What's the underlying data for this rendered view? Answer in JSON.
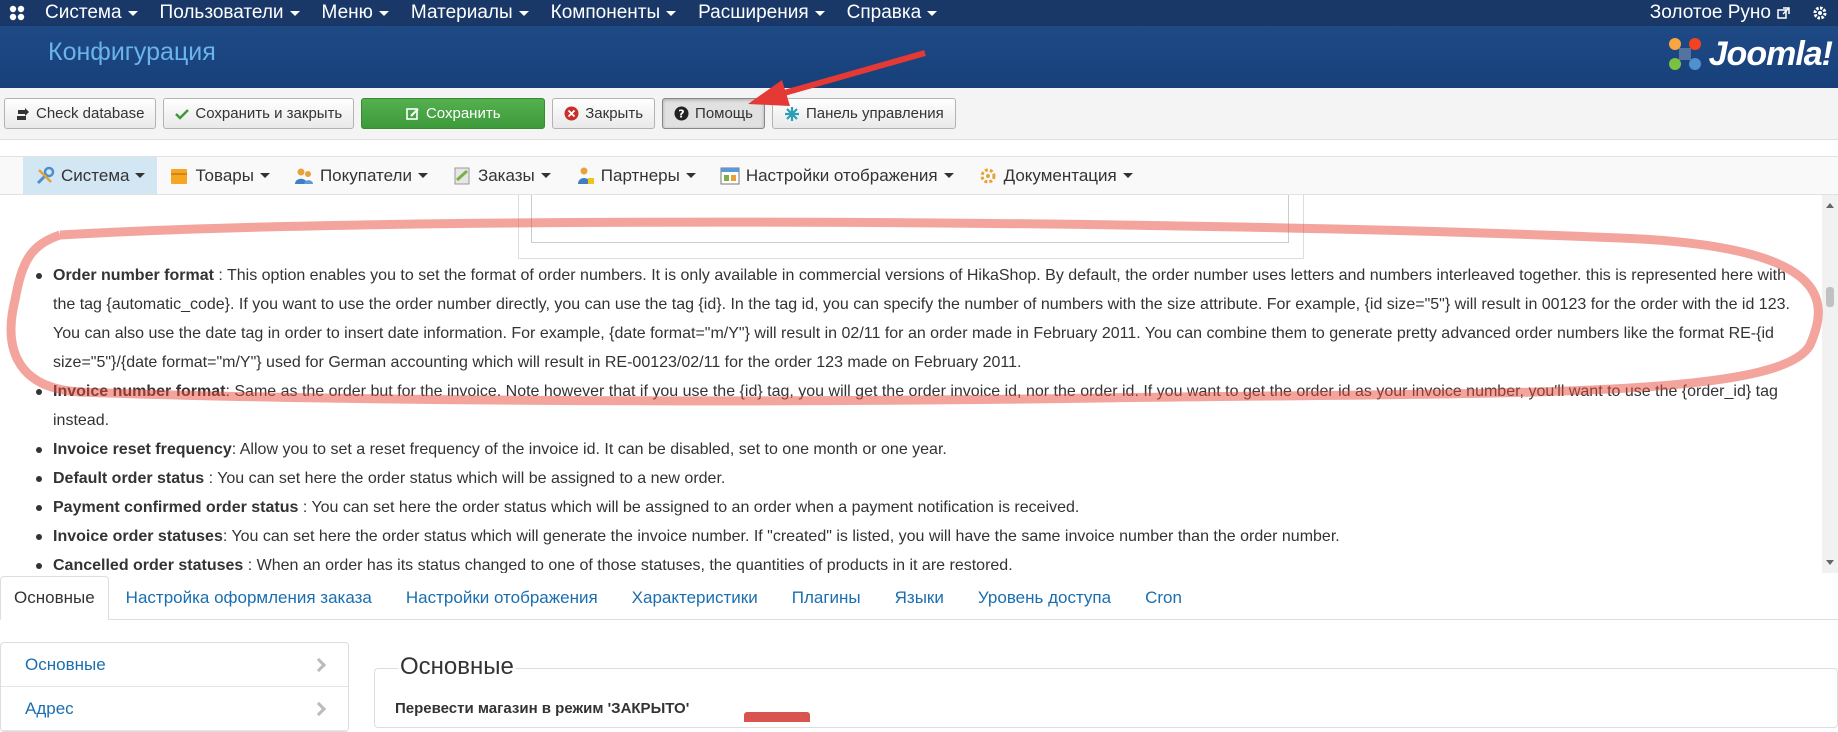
{
  "topnav": {
    "items": [
      {
        "label": "Система"
      },
      {
        "label": "Пользователи"
      },
      {
        "label": "Меню"
      },
      {
        "label": "Материалы"
      },
      {
        "label": "Компоненты"
      },
      {
        "label": "Расширения"
      },
      {
        "label": "Справка"
      }
    ],
    "site_name": "Золотое Руно"
  },
  "header": {
    "title": "Конфигурация",
    "brand": "Joomla!"
  },
  "toolbar": {
    "check_db": "Check database",
    "save_close": "Сохранить и закрыть",
    "save": "Сохранить",
    "close": "Закрыть",
    "help": "Помощь",
    "dashboard": "Панель управления"
  },
  "hikamenu": {
    "items": [
      {
        "label": "Система"
      },
      {
        "label": "Товары"
      },
      {
        "label": "Покупатели"
      },
      {
        "label": "Заказы"
      },
      {
        "label": "Партнеры"
      },
      {
        "label": "Настройки отображения"
      },
      {
        "label": "Документация"
      }
    ]
  },
  "help": {
    "items": [
      {
        "term": "Order number format",
        "text": " : This option enables you to set the format of order numbers. It is only available in commercial versions of HikaShop. By default, the order number uses letters and numbers interleaved together. this is represented here with the tag {automatic_code}. If you want to use the order number directly, you can use the tag {id}. In the tag id, you can specify the number of numbers with the size attribute. For example, {id size=\"5\"} will result in 00123 for the order with the id 123. You can also use the date tag in order to insert date information. For example, {date format=\"m/Y\"} will result in 02/11 for an order made in February 2011. You can combine them to generate pretty advanced order numbers like the format RE-{id size=\"5\"}/{date format=\"m/Y\"} used for German accounting which will result in RE-00123/02/11 for the order 123 made on February 2011."
      },
      {
        "term": "Invoice number format",
        "text": ": Same as the order but for the invoice. Note however that if you use the {id} tag, you will get the order invoice id, nor the order id. If you want to get the order id as your invoice number, you'll want to use the {order_id} tag instead."
      },
      {
        "term": "Invoice reset frequency",
        "text": ": Allow you to set a reset frequency of the invoice id. It can be disabled, set to one month or one year."
      },
      {
        "term": "Default order status",
        "text": " : You can set here the order status which will be assigned to a new order."
      },
      {
        "term": "Payment confirmed order status",
        "text": " : You can set here the order status which will be assigned to an order when a payment notification is received."
      },
      {
        "term": "Invoice order statuses",
        "text": ": You can set here the order status which will generate the invoice number. If \"created\" is listed, you will have the same invoice number than the order number."
      },
      {
        "term": "Cancelled order statuses",
        "text": " : When an order has its status changed to one of those statuses, the quantities of products in it are restored."
      }
    ]
  },
  "tabs": [
    {
      "label": "Основные"
    },
    {
      "label": "Настройка оформления заказа"
    },
    {
      "label": "Настройки отображения"
    },
    {
      "label": "Характеристики"
    },
    {
      "label": "Плагины"
    },
    {
      "label": "Языки"
    },
    {
      "label": "Уровень доступа"
    },
    {
      "label": "Cron"
    }
  ],
  "sidenav": {
    "items": [
      {
        "label": "Основные"
      },
      {
        "label": "Адрес"
      }
    ]
  },
  "section": {
    "legend": "Основные",
    "field_label": "Перевести магазин в режим 'ЗАКРЫТО'"
  },
  "colors": {
    "topnav_bg": "#1a3867",
    "header_bg": "#1e4a85",
    "link": "#1a6eb0",
    "save_green": "#46a546",
    "annotation_red": "#e74c3c"
  }
}
